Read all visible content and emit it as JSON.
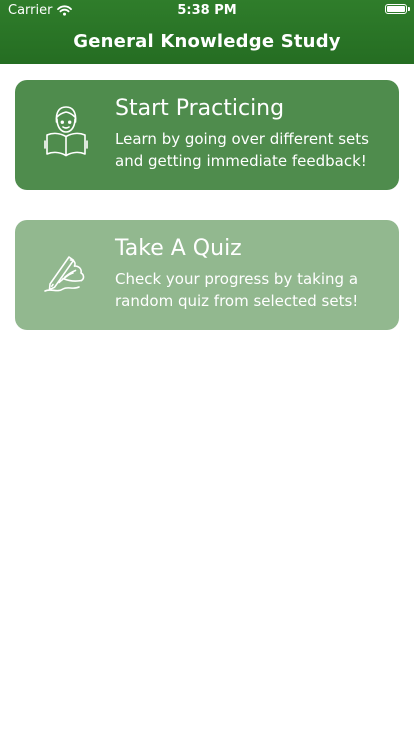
{
  "status_bar": {
    "carrier": "Carrier",
    "time": "5:38 PM",
    "wifi_icon": "wifi-icon",
    "battery_icon": "battery-icon"
  },
  "nav": {
    "title": "General Knowledge Study"
  },
  "cards": [
    {
      "title": "Start Practicing",
      "description": "Learn by going over different sets and getting immediate feedback!",
      "icon": "reading-person-icon",
      "color": "#4f8c4d"
    },
    {
      "title": "Take A Quiz",
      "description": "Check your progress by taking a random quiz from selected sets!",
      "icon": "writing-hand-icon",
      "color": "#92b88f"
    }
  ],
  "theme": {
    "header_color": "#2b7827",
    "text_color": "#ffffff"
  }
}
